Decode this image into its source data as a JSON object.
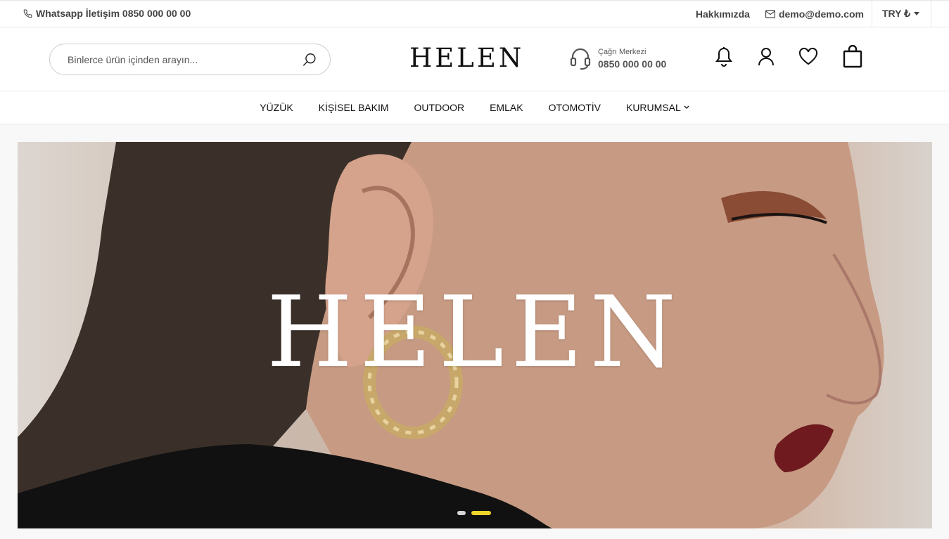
{
  "topbar": {
    "whatsapp": "Whatsapp İletişim 0850 000 00 00",
    "about": "Hakkımızda",
    "email": "demo@demo.com",
    "currency": "TRY ₺"
  },
  "header": {
    "search_placeholder": "Binlerce ürün içinden arayın...",
    "logo": "HELEN",
    "callcenter_label": "Çağrı Merkezi",
    "callcenter_number": "0850 000 00 00"
  },
  "nav": {
    "items": [
      "YÜZÜK",
      "KİŞİSEL BAKIM",
      "OUTDOOR",
      "EMLAK",
      "OTOMOTİV",
      "KURUMSAL"
    ]
  },
  "hero": {
    "title": "HELEN",
    "slide_count": 2,
    "active_slide": 2
  },
  "colors": {
    "accent": "#f0d42c",
    "text": "#222222"
  }
}
